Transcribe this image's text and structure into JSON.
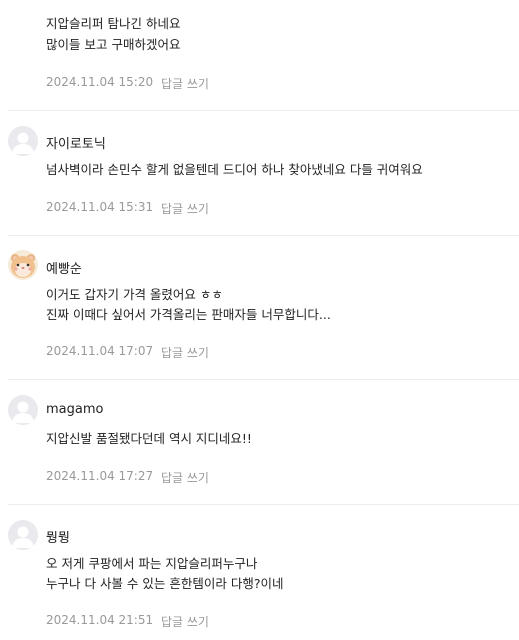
{
  "comments": [
    {
      "author": "",
      "lines": [
        "지압슬리퍼 탐나긴 하네요",
        "많이들 보고 구매하겠어요"
      ],
      "timestamp": "2024.11.04 15:20",
      "reply_label": "답글 쓰기",
      "avatar": "none"
    },
    {
      "author": "자이로토닉",
      "lines": [
        "넘사벽이라 손민수 할게 없을텐데 드디어 하나 찾아냈네요 다들 귀여워요"
      ],
      "timestamp": "2024.11.04 15:31",
      "reply_label": "답글 쓰기",
      "avatar": "default-user-icon"
    },
    {
      "author": "예빵순",
      "lines": [
        "이거도 갑자기 가격 올렸어요 ㅎㅎ",
        "진짜 이때다 싶어서 가격올리는 판매자들 너무합니다..."
      ],
      "timestamp": "2024.11.04 17:07",
      "reply_label": "답글 쓰기",
      "avatar": "hamster-avatar"
    },
    {
      "author": "magamo",
      "lines": [
        "지압신발 품절됐다던데 역시 지디네요!!"
      ],
      "timestamp": "2024.11.04 17:27",
      "reply_label": "답글 쓰기",
      "avatar": "default-user-icon"
    },
    {
      "author": "뭥뭥",
      "lines": [
        "오 저게 쿠팡에서 파는 지압슬리퍼누구나",
        "누구나 다 사볼 수 있는 흔한템이라 다행?이네"
      ],
      "timestamp": "2024.11.04 21:51",
      "reply_label": "답글 쓰기",
      "avatar": "default-user-icon"
    }
  ],
  "colors": {
    "text": "#222222",
    "meta": "#999999",
    "divider": "#ececec",
    "avatar_bg": "#e9e9ee"
  }
}
